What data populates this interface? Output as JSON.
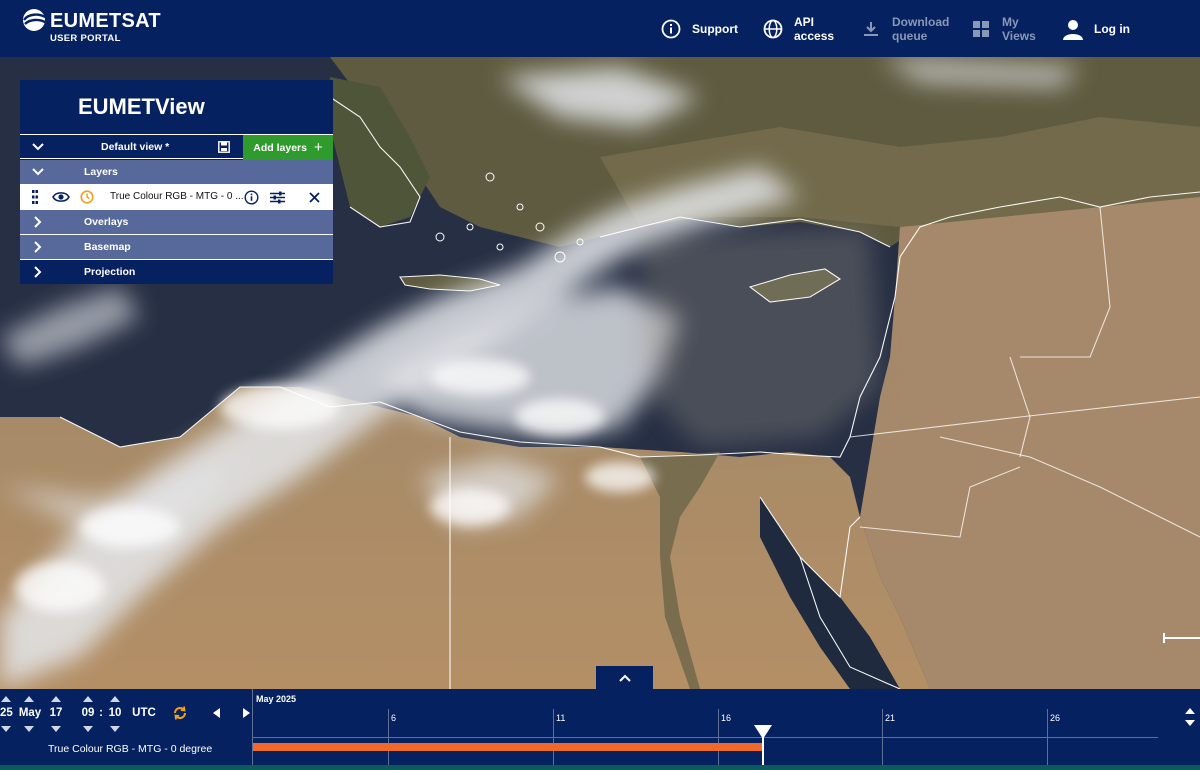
{
  "header": {
    "brand": "EUMETSAT",
    "subtitle": "USER PORTAL",
    "nav": {
      "support": "Support",
      "api_line1": "API",
      "api_line2": "access",
      "download_line1": "Download",
      "download_line2": "queue",
      "views_line1": "My",
      "views_line2": "Views",
      "login": "Log in"
    }
  },
  "panel": {
    "title": "EUMETView",
    "view_name": "Default view *",
    "add_layers": "Add layers",
    "sections": {
      "layers": "Layers",
      "overlays": "Overlays",
      "basemap": "Basemap",
      "projection": "Projection"
    },
    "layer": {
      "name": "True Colour RGB - MTG - 0 ...",
      "visible": true
    }
  },
  "timeline": {
    "date": {
      "prev_day": "25",
      "month": "May",
      "day": "17",
      "hour": "09",
      "minute": "10",
      "tz": "UTC"
    },
    "month_label": "May 2025",
    "ticks": [
      "6",
      "11",
      "16",
      "21",
      "26"
    ],
    "layer_label": "True Colour RGB - MTG - 0 degree"
  },
  "colors": {
    "header_bg": "#052160",
    "add_button": "#2e9b2c",
    "section_bg": "#56699a",
    "time_bar": "#f0682a",
    "clock_icon": "#f0a020"
  },
  "icons": [
    "info-icon",
    "globe-icon",
    "download-icon",
    "grid-icon",
    "user-icon",
    "chevron-down-icon",
    "chevron-right-icon",
    "save-icon",
    "plus-icon",
    "drag-handle-icon",
    "eye-icon",
    "clock-icon",
    "sliders-icon",
    "close-icon",
    "chevron-up-icon",
    "refresh-icon",
    "play-left-icon",
    "play-right-icon"
  ]
}
